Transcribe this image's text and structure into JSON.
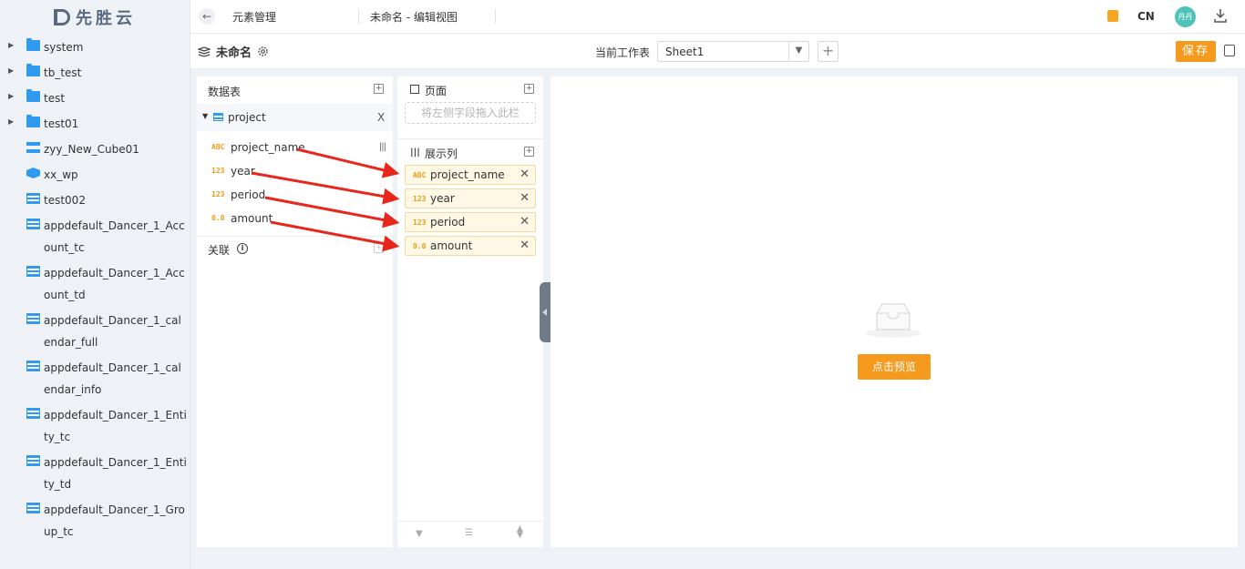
{
  "app": {
    "brand": "先胜云"
  },
  "sidebar": {
    "items": [
      {
        "label": "system",
        "icon": "folder-icon",
        "expandable": true
      },
      {
        "label": "tb_test",
        "icon": "folder-icon",
        "expandable": true
      },
      {
        "label": "test",
        "icon": "folder-icon",
        "expandable": true
      },
      {
        "label": "test01",
        "icon": "folder-icon",
        "expandable": true
      },
      {
        "label": "zyy_New_Cube01",
        "icon": "tree-icon",
        "expandable": false
      },
      {
        "label": "xx_wp",
        "icon": "cube-icon",
        "expandable": false
      },
      {
        "label": "test002",
        "icon": "table-icon",
        "expandable": false
      },
      {
        "label": "appdefault_Dancer_1_Account_tc",
        "icon": "table-icon",
        "expandable": false
      },
      {
        "label": "appdefault_Dancer_1_Account_td",
        "icon": "table-icon",
        "expandable": false
      },
      {
        "label": "appdefault_Dancer_1_calendar_full",
        "icon": "table-icon",
        "expandable": false
      },
      {
        "label": "appdefault_Dancer_1_calendar_info",
        "icon": "table-icon",
        "expandable": false
      },
      {
        "label": "appdefault_Dancer_1_Entity_tc",
        "icon": "table-icon",
        "expandable": false
      },
      {
        "label": "appdefault_Dancer_1_Entity_td",
        "icon": "table-icon",
        "expandable": false
      },
      {
        "label": "appdefault_Dancer_1_Group_tc",
        "icon": "table-icon",
        "expandable": false
      }
    ]
  },
  "topbar": {
    "crumb_module": "元素管理",
    "crumb_page": "未命名 - 编辑视图",
    "lang": "CN",
    "avatar_text": "丹丹"
  },
  "toolbar": {
    "view_name": "未命名",
    "sheet_label": "当前工作表",
    "sheet_value": "Sheet1",
    "save_label": "保存"
  },
  "fields_panel": {
    "title": "数据表",
    "table_name": "project",
    "table_close": "X",
    "fields": [
      {
        "type": "ABC",
        "name": "project_name"
      },
      {
        "type": "123",
        "name": "year"
      },
      {
        "type": "123",
        "name": "period"
      },
      {
        "type": "0.0",
        "name": "amount"
      }
    ],
    "relation_label": "关联"
  },
  "columns_panel": {
    "page_title": "页面",
    "page_placeholder": "将左侧字段拖入此栏",
    "display_title": "展示列",
    "columns": [
      {
        "type": "ABC",
        "name": "project_name"
      },
      {
        "type": "123",
        "name": "year"
      },
      {
        "type": "123",
        "name": "period"
      },
      {
        "type": "0.0",
        "name": "amount"
      }
    ]
  },
  "canvas": {
    "preview_label": "点击预览"
  },
  "colors": {
    "accent": "#f59a1c",
    "link": "#2e9bf0",
    "arrow": "#e8271c"
  }
}
